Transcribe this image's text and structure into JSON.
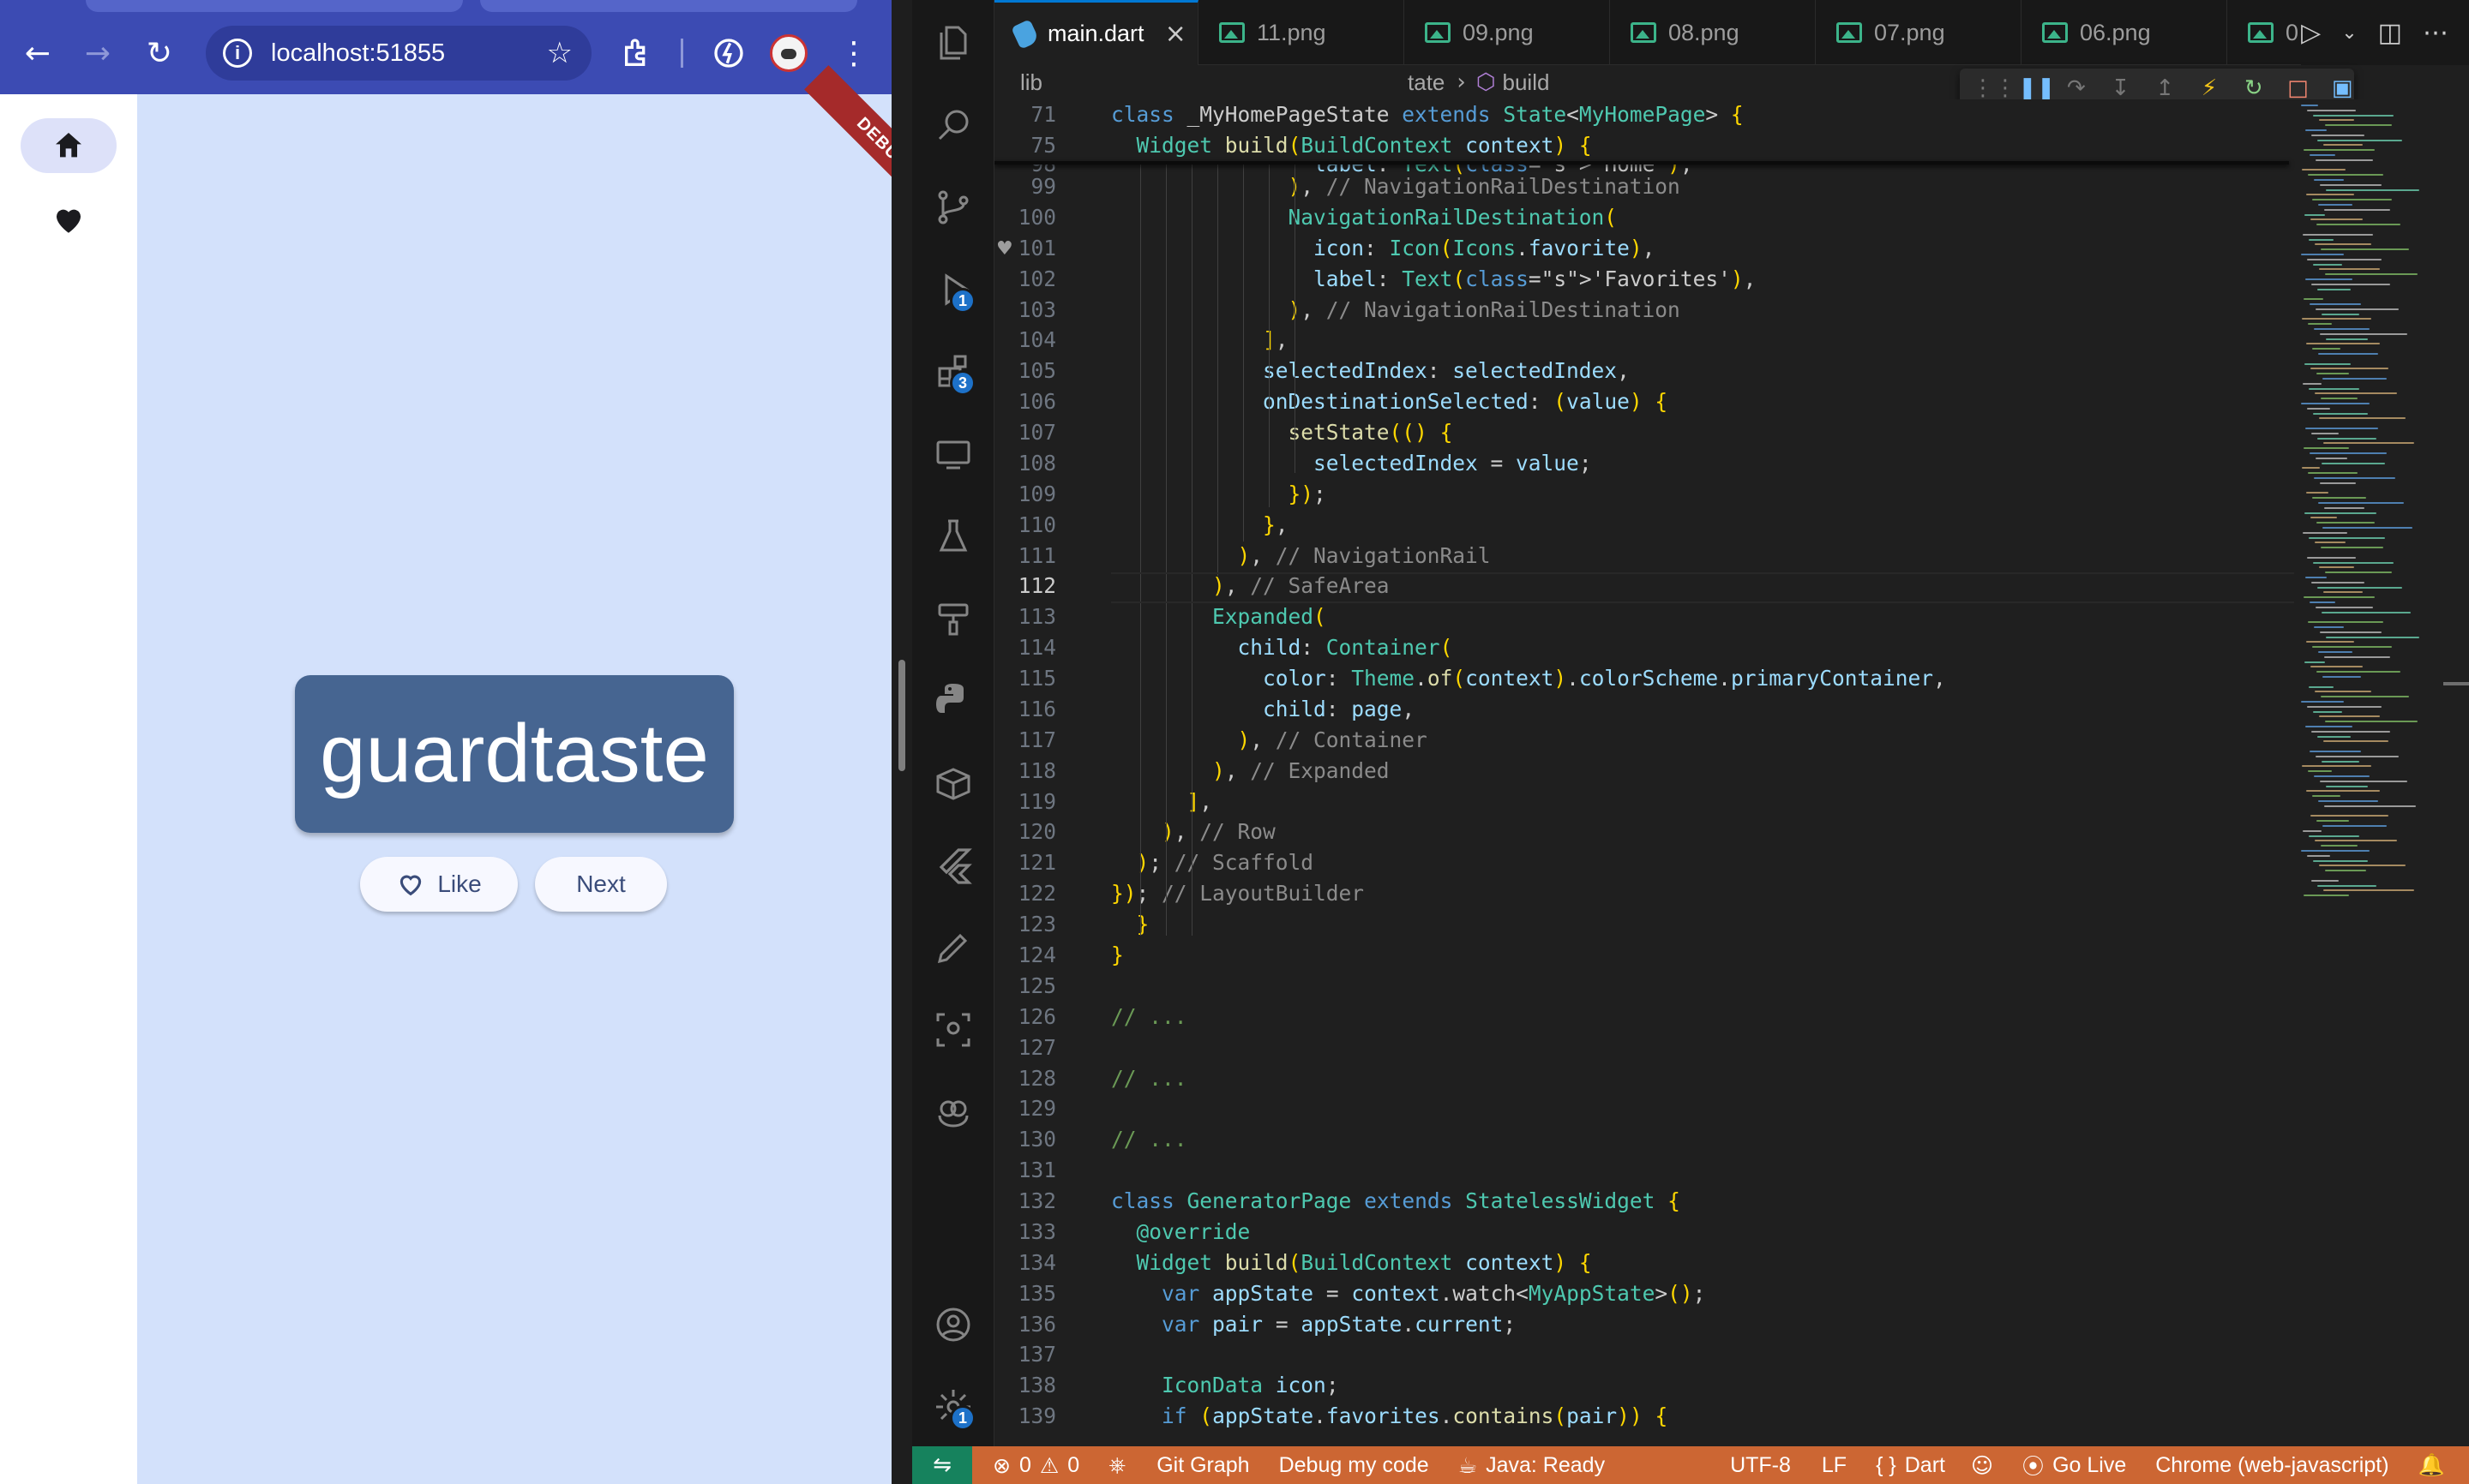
{
  "browser": {
    "url": "localhost:51855",
    "word": "guardtaste",
    "like_label": "Like",
    "next_label": "Next",
    "debug_banner": "DEBUG",
    "rail_items": [
      {
        "icon": "home-icon"
      },
      {
        "icon": "heart-icon"
      }
    ]
  },
  "vscode": {
    "tabs": [
      {
        "label": "main.dart",
        "active": true
      },
      {
        "label": "11.png"
      },
      {
        "label": "09.png"
      },
      {
        "label": "08.png"
      },
      {
        "label": "07.png"
      },
      {
        "label": "06.png"
      },
      {
        "label": "0"
      }
    ],
    "breadcrumb": {
      "root": "lib",
      "state": "tate",
      "symbol": "build"
    },
    "sticky": [
      {
        "num": "71",
        "code": "class _MyHomePageState extends State<MyHomePage> {"
      },
      {
        "num": "75",
        "code": "  Widget build(BuildContext context) {"
      }
    ],
    "partial_line": {
      "num": "98",
      "code": "                label: Text('Home'),"
    },
    "lines": [
      {
        "num": "99",
        "code": "              ), // NavigationRailDestination"
      },
      {
        "num": "100",
        "code": "              NavigationRailDestination("
      },
      {
        "num": "101",
        "code": "                icon: Icon(Icons.favorite),"
      },
      {
        "num": "102",
        "code": "                label: Text('Favorites'),"
      },
      {
        "num": "103",
        "code": "              ), // NavigationRailDestination"
      },
      {
        "num": "104",
        "code": "            ],"
      },
      {
        "num": "105",
        "code": "            selectedIndex: selectedIndex,"
      },
      {
        "num": "106",
        "code": "            onDestinationSelected: (value) {"
      },
      {
        "num": "107",
        "code": "              setState(() {"
      },
      {
        "num": "108",
        "code": "                selectedIndex = value;"
      },
      {
        "num": "109",
        "code": "              });"
      },
      {
        "num": "110",
        "code": "            },"
      },
      {
        "num": "111",
        "code": "          ), // NavigationRail"
      },
      {
        "num": "112",
        "code": "        ), // SafeArea"
      },
      {
        "num": "113",
        "code": "        Expanded("
      },
      {
        "num": "114",
        "code": "          child: Container("
      },
      {
        "num": "115",
        "code": "            color: Theme.of(context).colorScheme.primaryContainer,"
      },
      {
        "num": "116",
        "code": "            child: page,"
      },
      {
        "num": "117",
        "code": "          ), // Container"
      },
      {
        "num": "118",
        "code": "        ), // Expanded"
      },
      {
        "num": "119",
        "code": "      ],"
      },
      {
        "num": "120",
        "code": "    ), // Row"
      },
      {
        "num": "121",
        "code": "  ); // Scaffold"
      },
      {
        "num": "122",
        "code": "}); // LayoutBuilder"
      },
      {
        "num": "123",
        "code": "  }"
      },
      {
        "num": "124",
        "code": "}"
      },
      {
        "num": "125",
        "code": ""
      },
      {
        "num": "126",
        "code": "// ..."
      },
      {
        "num": "127",
        "code": ""
      },
      {
        "num": "128",
        "code": "// ..."
      },
      {
        "num": "129",
        "code": ""
      },
      {
        "num": "130",
        "code": "// ..."
      },
      {
        "num": "131",
        "code": ""
      },
      {
        "num": "132",
        "code": "class GeneratorPage extends StatelessWidget {"
      },
      {
        "num": "133",
        "code": "  @override"
      },
      {
        "num": "134",
        "code": "  Widget build(BuildContext context) {"
      },
      {
        "num": "135",
        "code": "    var appState = context.watch<MyAppState>();"
      },
      {
        "num": "136",
        "code": "    var pair = appState.current;"
      },
      {
        "num": "137",
        "code": ""
      },
      {
        "num": "138",
        "code": "    IconData icon;"
      },
      {
        "num": "139",
        "code": "    if (appState.favorites.contains(pair)) {"
      }
    ],
    "current_line": "112",
    "activity_badges": {
      "run_debug": "1",
      "extensions": "3",
      "settings": "1"
    },
    "status": {
      "errors": "0",
      "warnings": "0",
      "git_graph": "Git Graph",
      "debug": "Debug my code",
      "java": "Java: Ready",
      "encoding": "UTF-8",
      "eol": "LF",
      "language": "Dart",
      "go_live": "Go Live",
      "target": "Chrome (web-javascript)"
    }
  }
}
